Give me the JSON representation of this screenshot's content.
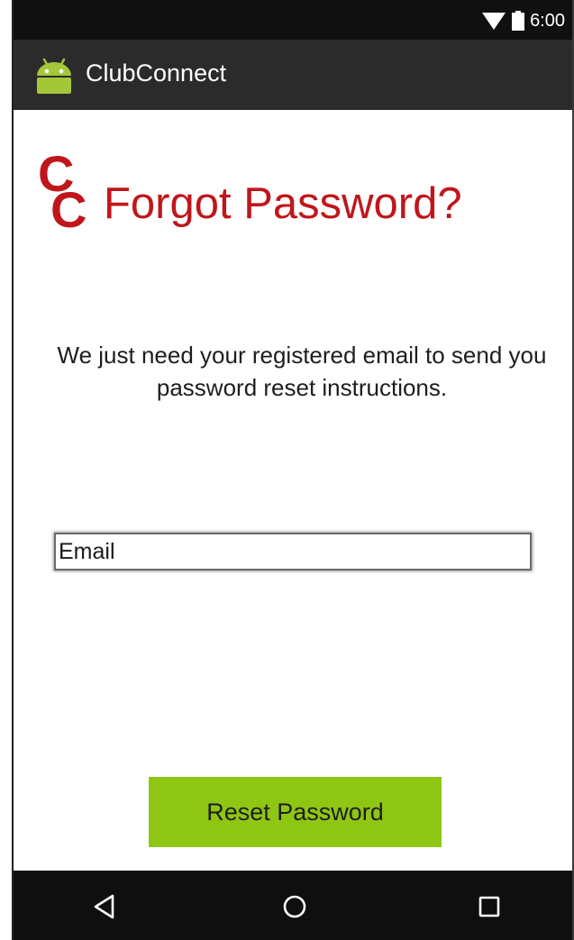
{
  "status_bar": {
    "time": "6:00",
    "icons": [
      "wifi-icon",
      "battery-icon"
    ]
  },
  "app_bar": {
    "title": "ClubConnect",
    "icon": "android-icon"
  },
  "header": {
    "logo_text": "CC",
    "title": "Forgot Password?"
  },
  "main": {
    "instructions": "We just need your registered email to send you password reset instructions.",
    "email_field": {
      "placeholder": "Email",
      "value": ""
    },
    "reset_button_label": "Reset Password"
  },
  "nav_bar": {
    "icons": [
      "back-icon",
      "home-icon",
      "recents-icon"
    ]
  },
  "colors": {
    "accent_red": "#c0161b",
    "button_green": "#8fc613",
    "app_bar": "#2b2b2b",
    "status_bar": "#101010"
  }
}
